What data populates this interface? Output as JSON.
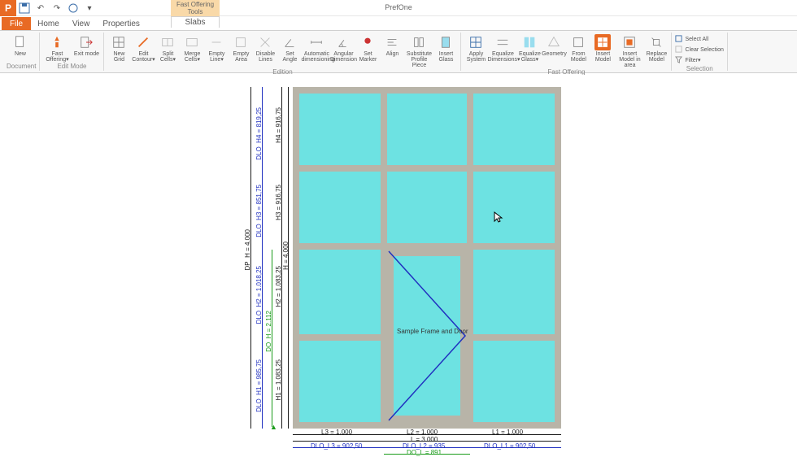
{
  "app": {
    "title": "PrefOne",
    "icon_letter": "P"
  },
  "qat": {
    "save": "save",
    "undo": "undo",
    "redo": "redo",
    "refresh": "refresh"
  },
  "tabs": {
    "file": "File",
    "items": [
      "Home",
      "View",
      "Properties"
    ],
    "contextual_header": "Fast Offering Tools",
    "contextual_tab": "Slabs"
  },
  "ribbon": {
    "groups": [
      {
        "label": "Document",
        "buttons": [
          {
            "name": "new",
            "label": "New"
          }
        ]
      },
      {
        "label": "Edit Mode",
        "buttons": [
          {
            "name": "fast-offering",
            "label": "Fast\nOffering▾"
          },
          {
            "name": "exit-mode",
            "label": "Exit\nmode"
          }
        ]
      },
      {
        "label": "Edition",
        "buttons": [
          {
            "name": "new-grid",
            "label": "New\nGrid"
          },
          {
            "name": "edit-contour",
            "label": "Edit\nContour▾"
          },
          {
            "name": "split-cells",
            "label": "Split\nCells▾"
          },
          {
            "name": "merge-cells",
            "label": "Merge\nCells▾"
          },
          {
            "name": "empty-line",
            "label": "Empty\nLine▾"
          },
          {
            "name": "empty-area",
            "label": "Empty\nArea"
          },
          {
            "name": "disable-lines",
            "label": "Disable\nLines"
          },
          {
            "name": "set-angle",
            "label": "Set\nAngle"
          },
          {
            "name": "auto-dim",
            "label": "Automatic\ndimensioning"
          },
          {
            "name": "ang-dim",
            "label": "Angular\nDimension"
          },
          {
            "name": "set-marker",
            "label": "Set\nMarker"
          },
          {
            "name": "align",
            "label": "Align"
          },
          {
            "name": "substitute-prof",
            "label": "Substitute\nProfile Piece"
          },
          {
            "name": "insert-glass",
            "label": "Insert\nGlass"
          }
        ]
      },
      {
        "label": "Fast Offering",
        "buttons": [
          {
            "name": "apply-system",
            "label": "Apply\nSystem"
          },
          {
            "name": "equalize-dims",
            "label": "Equalize\nDimensions▾"
          },
          {
            "name": "equalize-glass",
            "label": "Equalize\nGlass▾"
          },
          {
            "name": "geometry",
            "label": "Geometry"
          },
          {
            "name": "from-model",
            "label": "From\nModel"
          },
          {
            "name": "insert-model",
            "label": "Insert\nModel",
            "highlight": true
          },
          {
            "name": "insert-model-area",
            "label": "Insert\nModel in area"
          },
          {
            "name": "replace-model",
            "label": "Replace\nModel"
          }
        ]
      },
      {
        "label": "Selection",
        "stack": [
          {
            "name": "select-all",
            "label": "Select All"
          },
          {
            "name": "clear-selection",
            "label": "Clear Selection"
          },
          {
            "name": "filter",
            "label": "Filter▾"
          }
        ]
      }
    ]
  },
  "drawing": {
    "sample_label": "Sample Frame and Door",
    "vdims_left_outer": "DP_H = 4.000",
    "vdims_left": [
      "DLO_H4 = 819,25",
      "DLO_H3 = 851,75",
      "DLO_H2 = 1.018,25",
      "DLO_H1 = 985,75"
    ],
    "door_h": "DO_H = 2.112",
    "vdims_inner": [
      "H4 = 916,75",
      "H3 = 916,75",
      "H2 = 1.083,25",
      "H1 = 1.083,25"
    ],
    "h_inner_total": "H = 4.000",
    "hdims_bottom": [
      "L3 = 1.000",
      "L2 = 1.000",
      "L1 = 1.000"
    ],
    "hdim_total": "L = 3.000",
    "hdims_dlo": [
      "DLO_L3 = 902,50",
      "DLO_L2 = 935",
      "DLO_L1 = 902,50"
    ],
    "hdim_door": "DO_L = 891"
  }
}
